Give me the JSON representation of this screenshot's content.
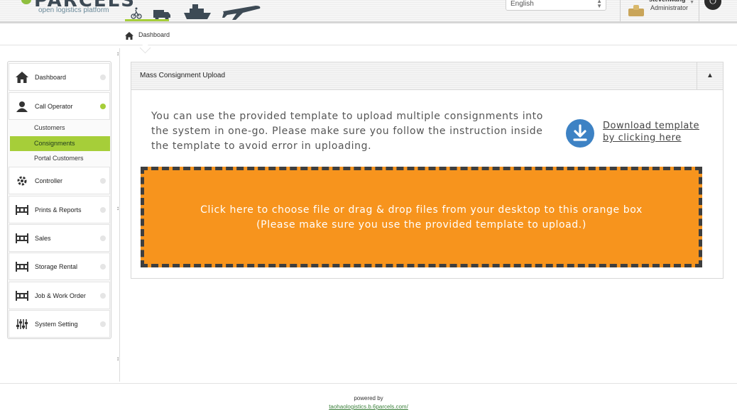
{
  "brand": {
    "logo_text": "PARCELS",
    "tagline": "open logistics platform"
  },
  "header": {
    "transport_icons": [
      "bicycle-icon",
      "van-icon",
      "ship-icon",
      "airplane-icon"
    ],
    "language": {
      "selected": "English"
    },
    "user": {
      "name": "stevenwang",
      "role": "Administrator"
    }
  },
  "breadcrumb": {
    "label": "Dashboard"
  },
  "sidebar": {
    "items": [
      {
        "label": "Dashboard",
        "icon": "home-icon"
      },
      {
        "label": "Call Operator",
        "icon": "operator-icon"
      },
      {
        "label": "Controller",
        "icon": "gear-icon"
      },
      {
        "label": "Prints & Reports",
        "icon": "grid-icon"
      },
      {
        "label": "Sales",
        "icon": "grid-icon"
      },
      {
        "label": "Storage Rental",
        "icon": "grid-icon"
      },
      {
        "label": "Job & Work Order",
        "icon": "grid-icon"
      },
      {
        "label": "System Setting",
        "icon": "sliders-icon"
      }
    ],
    "submenu": [
      {
        "label": "Customers"
      },
      {
        "label": "Consignments"
      },
      {
        "label": "Portal Customers"
      }
    ]
  },
  "panel": {
    "title": "Mass Consignment Upload",
    "instructions": "You can use the provided template to upload multiple consignments into the system in one-go. Please make sure you follow the instruction inside the template to avoid error in uploading.",
    "download_line1": "Download template",
    "download_line2": "by clicking here",
    "dropzone_line1": "Click here to choose file or drag & drop files from your desktop to this orange box",
    "dropzone_line2": "(Please make sure you use the provided template to upload.)"
  },
  "footer": {
    "powered_by": "powered by",
    "link": "taohaologistics.b.6parcels.com/"
  },
  "colors": {
    "accent_green": "#a6ce39",
    "dropzone_orange": "#f7941d",
    "download_blue": "#3d82c4"
  }
}
